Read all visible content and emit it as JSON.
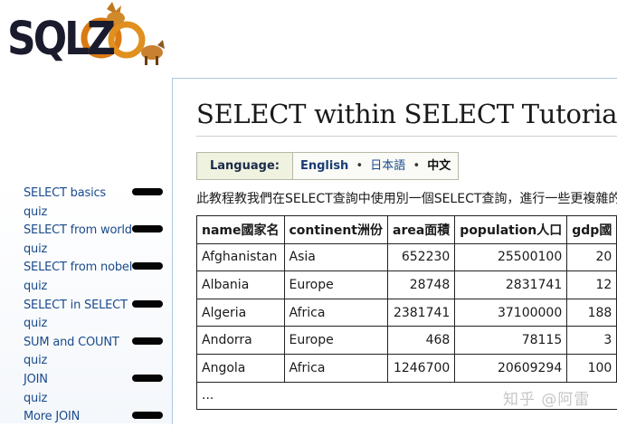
{
  "logo": {
    "text": "SQLZ"
  },
  "nav": [
    {
      "label": "SELECT basics"
    },
    {
      "label": "quiz"
    },
    {
      "label": "SELECT from world"
    },
    {
      "label": "quiz"
    },
    {
      "label": "SELECT from nobel"
    },
    {
      "label": "quiz"
    },
    {
      "label": "SELECT in SELECT"
    },
    {
      "label": "quiz"
    },
    {
      "label": "SUM and COUNT"
    },
    {
      "label": "quiz"
    },
    {
      "label": "JOIN"
    },
    {
      "label": "quiz"
    },
    {
      "label": "More JOIN"
    }
  ],
  "main": {
    "title": "SELECT within SELECT Tutorial",
    "language": {
      "label": "Language:",
      "english": "English",
      "japanese": "日本語",
      "chinese": "中文"
    },
    "intro": "此教程教我們在SELECT查詢中使用別一個SELECT查詢，進行一些更複雜的查詢。",
    "table": {
      "headers": [
        "name國家名",
        "continent洲份",
        "area面積",
        "population人口",
        "gdp國"
      ],
      "rows": [
        [
          "Afghanistan",
          "Asia",
          "652230",
          "25500100",
          "20"
        ],
        [
          "Albania",
          "Europe",
          "28748",
          "2831741",
          "12"
        ],
        [
          "Algeria",
          "Africa",
          "2381741",
          "37100000",
          "188"
        ],
        [
          "Andorra",
          "Europe",
          "468",
          "78115",
          "3"
        ],
        [
          "Angola",
          "Africa",
          "1246700",
          "20609294",
          "100"
        ]
      ],
      "ellipsis": "..."
    }
  },
  "watermark": "知乎 @阿雷",
  "colors": {
    "link": "#1a4b8c",
    "frame_border": "#aac9e6",
    "lang_label_bg": "#eef2de"
  }
}
